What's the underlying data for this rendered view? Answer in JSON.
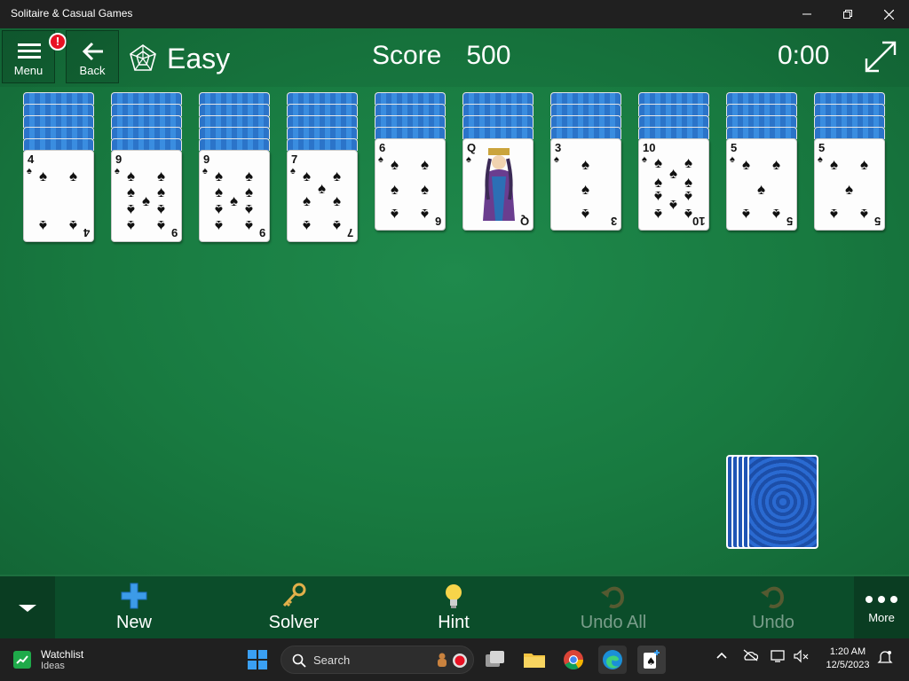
{
  "window": {
    "title": "Solitaire & Casual Games"
  },
  "header": {
    "menu_label": "Menu",
    "menu_alert": "!",
    "back_label": "Back",
    "difficulty": "Easy",
    "score_label": "Score",
    "score_value": "500",
    "timer": "0:00"
  },
  "tableau": [
    {
      "rank": "4",
      "suit": "♠",
      "face_down": 5
    },
    {
      "rank": "9",
      "suit": "♠",
      "face_down": 5
    },
    {
      "rank": "9",
      "suit": "♠",
      "face_down": 5
    },
    {
      "rank": "7",
      "suit": "♠",
      "face_down": 5
    },
    {
      "rank": "6",
      "suit": "♠",
      "face_down": 4
    },
    {
      "rank": "Q",
      "suit": "♠",
      "face_down": 4
    },
    {
      "rank": "3",
      "suit": "♠",
      "face_down": 4
    },
    {
      "rank": "10",
      "suit": "♠",
      "face_down": 4
    },
    {
      "rank": "5",
      "suit": "♠",
      "face_down": 4
    },
    {
      "rank": "5",
      "suit": "♠",
      "face_down": 4
    }
  ],
  "stock": {
    "piles": 5
  },
  "toolbar": {
    "new_label": "New",
    "solver_label": "Solver",
    "hint_label": "Hint",
    "undo_all_label": "Undo All",
    "undo_label": "Undo",
    "more_label": "More"
  },
  "taskbar": {
    "widget_title": "Watchlist",
    "widget_subtitle": "Ideas",
    "search_placeholder": "Search",
    "time": "1:20 AM",
    "date": "12/5/2023"
  },
  "colors": {
    "felt": "#187a40",
    "card_back": "#2b74c9",
    "toolbar": "#0b4d2a",
    "alert": "#e81123"
  }
}
